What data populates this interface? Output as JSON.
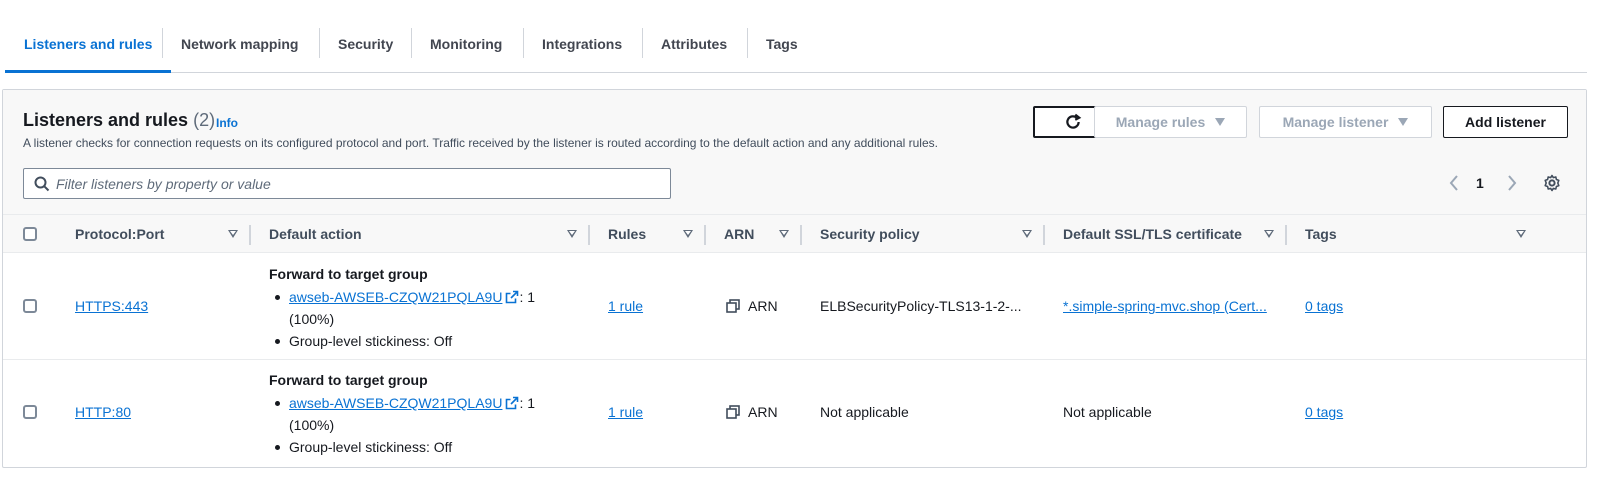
{
  "tabs": [
    {
      "label": "Listeners and rules",
      "active": true
    },
    {
      "label": "Network mapping",
      "active": false
    },
    {
      "label": "Security",
      "active": false
    },
    {
      "label": "Monitoring",
      "active": false
    },
    {
      "label": "Integrations",
      "active": false
    },
    {
      "label": "Attributes",
      "active": false
    },
    {
      "label": "Tags",
      "active": false
    }
  ],
  "panel": {
    "title": "Listeners and rules",
    "count": "(2)",
    "info_label": "Info",
    "description": "A listener checks for connection requests on its configured protocol and port. Traffic received by the listener is routed according to the default action and any additional rules.",
    "buttons": {
      "manage_rules": "Manage rules",
      "manage_listener": "Manage listener",
      "add_listener": "Add listener"
    },
    "search": {
      "placeholder": "Filter listeners by property or value",
      "value": ""
    },
    "pagination": {
      "current_page": "1"
    }
  },
  "table": {
    "columns": [
      "Protocol:Port",
      "Default action",
      "Rules",
      "ARN",
      "Security policy",
      "Default SSL/TLS certificate",
      "Tags"
    ],
    "rows": [
      {
        "protocol_port": "HTTPS:443",
        "action_title": "Forward to target group",
        "target_group": "awseb-AWSEB-CZQW21PQLA9U",
        "weight_suffix": ": 1",
        "weight_pct": "(100%)",
        "stickiness": "Group-level stickiness: Off",
        "rules": "1 rule",
        "arn": "ARN",
        "security_policy": "ELBSecurityPolicy-TLS13-1-2-...",
        "certificate": "*.simple-spring-mvc.shop (Cert...",
        "tags": "0 tags"
      },
      {
        "protocol_port": "HTTP:80",
        "action_title": "Forward to target group",
        "target_group": "awseb-AWSEB-CZQW21PQLA9U",
        "weight_suffix": ": 1",
        "weight_pct": "(100%)",
        "stickiness": "Group-level stickiness: Off",
        "rules": "1 rule",
        "arn": "ARN",
        "security_policy": "Not applicable",
        "certificate": "Not applicable",
        "tags": "0 tags"
      }
    ]
  },
  "colors": {
    "accent": "#0972d3",
    "text": "#16191f",
    "muted": "#5f6b7a",
    "disabled": "#9ba7b6"
  },
  "icons": [
    "refresh-icon",
    "caret-down-icon",
    "search-icon",
    "chevron-left-icon",
    "chevron-right-icon",
    "settings-gear-icon",
    "sort-icon",
    "external-link-icon",
    "copy-icon"
  ]
}
